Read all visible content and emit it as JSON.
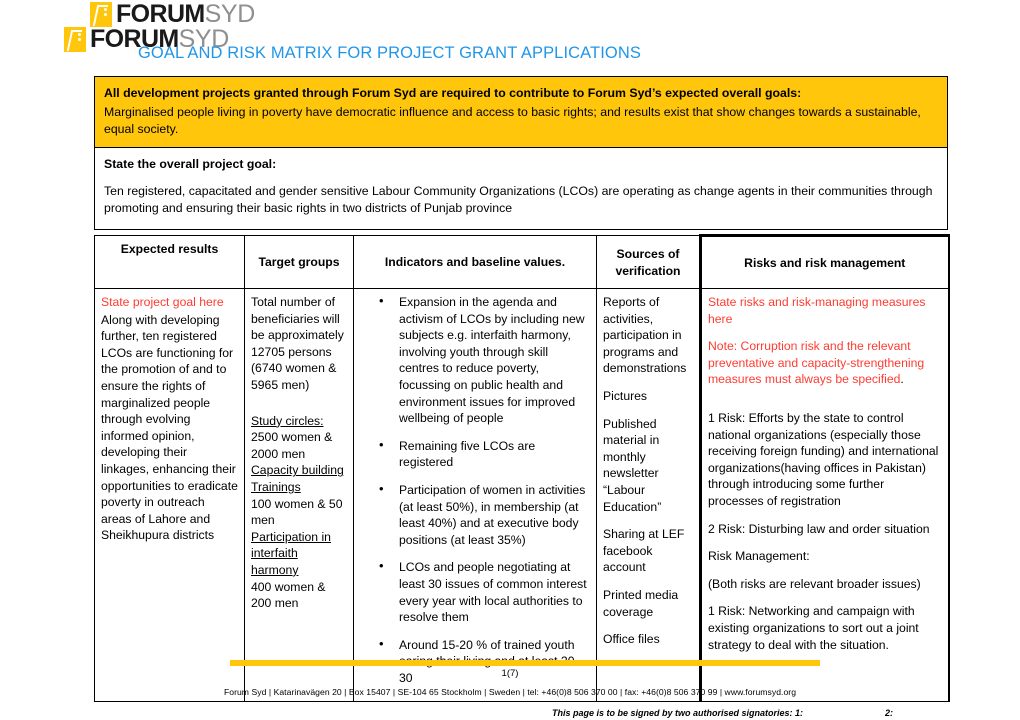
{
  "brand": {
    "logo_forum": "FORUM",
    "logo_syd": "SYD",
    "logo_mark_name": "forum-syd-logo-mark",
    "accent_yellow": "#FFC60B",
    "title_blue": "#2196E8",
    "red": "#FF3B30"
  },
  "document": {
    "title": "GOAL AND RISK MATRIX FOR PROJECT GRANT APPLICATIONS"
  },
  "overall_goal_box": {
    "heading": "All development projects granted through Forum Syd are required to contribute to Forum Syd’s expected overall goals:",
    "body": "Marginalised people living in poverty have democratic influence and access to basic rights; and results exist that show changes towards a sustainable, equal society."
  },
  "project_goal_box": {
    "heading": "State the overall project goal:",
    "body": "Ten registered, capacitated and gender sensitive Labour Community Organizations (LCOs) are operating as change agents in their communities through promoting and ensuring their basic rights in two districts of Punjab province"
  },
  "matrix": {
    "headers": [
      "Expected results",
      "Target groups",
      "Indicators and baseline values.",
      "Sources of verification",
      "Risks and risk management"
    ],
    "expected_results": {
      "placeholder": "State project goal here",
      "body": "Along with developing further, ten registered LCOs are functioning for the promotion of and to ensure the rights of marginalized people through evolving informed opinion, developing their linkages, enhancing their opportunities to eradicate poverty in outreach areas of Lahore and Sheikhupura districts"
    },
    "target_groups": {
      "total": "Total number of beneficiaries will be approximately 12705 persons (6740 women & 5965 men)",
      "group1_label": "Study circles:",
      "group1_value": "2500 women & 2000 men",
      "group2_label": "Capacity building Trainings",
      "group2_value": "100 women & 50 men",
      "group3_label": "Participation in interfaith harmony",
      "group3_value": "400 women & 200 men"
    },
    "indicators": [
      "Expansion in the agenda and activism of LCOs by including new subjects e.g. interfaith harmony, involving youth through skill centres to reduce poverty, focussing on public health and environment issues for  improved wellbeing of people",
      "Remaining five LCOs are registered",
      "Participation of women in activities (at least 50%), in membership (at least 40%) and at executive body positions (at least 35%)",
      "LCOs and people negotiating at least 30 issues of common interest every year with local authorities to resolve them",
      "Around 15-20 % of trained youth earing their living and at least 20-30"
    ],
    "sources": [
      "Reports of activities, participation in programs and demonstrations",
      "Pictures",
      "Published material in monthly newsletter “Labour Education”",
      "Sharing at LEF facebook account",
      "Printed media coverage",
      "Office files"
    ],
    "risks": {
      "placeholder": "State risks and risk-managing measures here",
      "note_red": "Note: Corruption risk and the relevant preventative and capacity-strengthening measures must always be specified",
      "note_tail": ".",
      "risk1": "1 Risk: Efforts by the state to control national organizations (especially those receiving foreign funding) and international organizations(having offices in Pakistan) through introducing some further processes of registration",
      "risk2": "2 Risk: Disturbing law and order situation",
      "management_label": "Risk Management:",
      "management_note": "(Both risks are relevant broader issues)",
      "management1": "1 Risk: Networking and campaign with existing organizations to sort out a joint strategy to deal with the situation."
    }
  },
  "footer": {
    "page_number": "1(7)",
    "address": "Forum Syd  |  Katarinavägen 20  |  Box 15407  |  SE-104 65 Stockholm  |  Sweden  |  tel: +46(0)8 506 370 00  |  fax: +46(0)8 506 370 99  |  www.forumsyd.org",
    "signatories": "This page is to be signed by two authorised signatories: 1:",
    "signatory_2": "2:"
  }
}
